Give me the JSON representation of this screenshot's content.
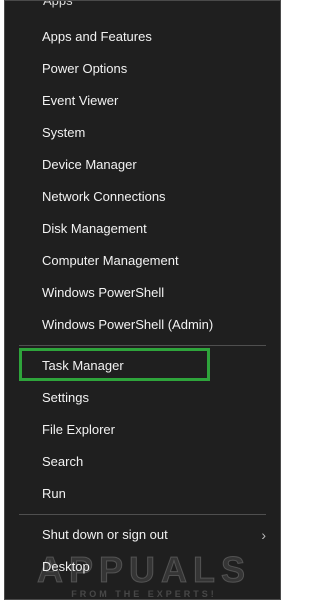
{
  "menu": {
    "cut_item": "Apps",
    "items": [
      {
        "label": "Apps and Features"
      },
      {
        "label": "Power Options"
      },
      {
        "label": "Event Viewer"
      },
      {
        "label": "System"
      },
      {
        "label": "Device Manager"
      },
      {
        "label": "Network Connections"
      },
      {
        "label": "Disk Management"
      },
      {
        "label": "Computer Management"
      },
      {
        "label": "Windows PowerShell"
      },
      {
        "label": "Windows PowerShell (Admin)"
      },
      {
        "label": "Task Manager"
      },
      {
        "label": "Settings"
      },
      {
        "label": "File Explorer"
      },
      {
        "label": "Search"
      },
      {
        "label": "Run"
      },
      {
        "label": "Shut down or sign out"
      },
      {
        "label": "Desktop"
      }
    ],
    "submenu_arrow": "›"
  },
  "highlight": {
    "color": "#2ea43b"
  },
  "watermark": {
    "brand": "APPUALS",
    "tagline": "FROM THE EXPERTS!"
  }
}
